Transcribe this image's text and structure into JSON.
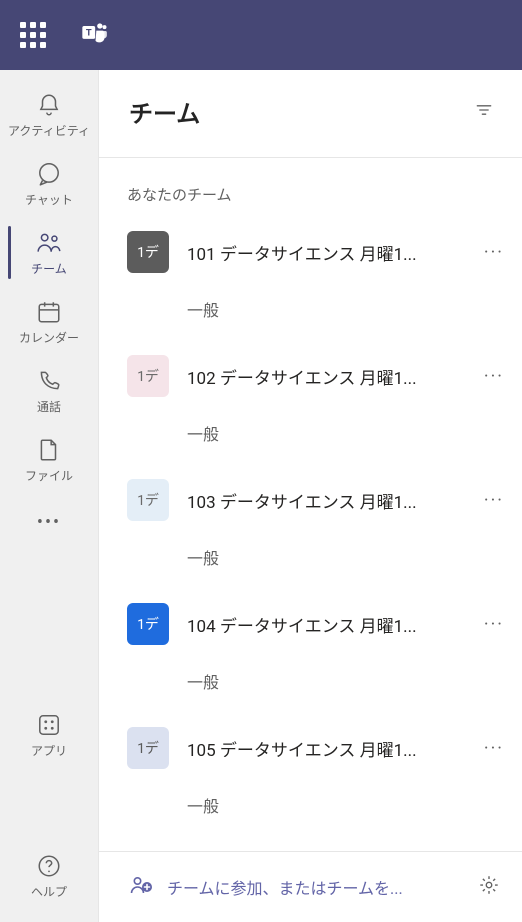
{
  "header": {
    "title": "チーム"
  },
  "section": {
    "label": "あなたのチーム"
  },
  "teams": [
    {
      "tile_text": "1デ",
      "tile_bg": "#5c5c5c",
      "tile_fg": "#ffffff",
      "name": "101 データサイエンス 月曜1...",
      "general": "一般"
    },
    {
      "tile_text": "1デ",
      "tile_bg": "#f5e4e9",
      "tile_fg": "#6a6a6a",
      "name": "102 データサイエンス 月曜1...",
      "general": "一般"
    },
    {
      "tile_text": "1デ",
      "tile_bg": "#e4eef7",
      "tile_fg": "#6a6a6a",
      "name": "103 データサイエンス 月曜1...",
      "general": "一般"
    },
    {
      "tile_text": "1デ",
      "tile_bg": "#1f6cde",
      "tile_fg": "#ffffff",
      "name": "104 データサイエンス 月曜1...",
      "general": "一般"
    },
    {
      "tile_text": "1デ",
      "tile_bg": "#dbe1f0",
      "tile_fg": "#5a5a5a",
      "name": "105 データサイエンス 月曜1...",
      "general": "一般"
    }
  ],
  "footer": {
    "join_text": "チームに参加、またはチームを..."
  },
  "rail": {
    "activity": "アクティビティ",
    "chat": "チャット",
    "teams": "チーム",
    "calendar": "カレンダー",
    "calls": "通話",
    "files": "ファイル",
    "apps": "アプリ",
    "help": "ヘルプ"
  }
}
